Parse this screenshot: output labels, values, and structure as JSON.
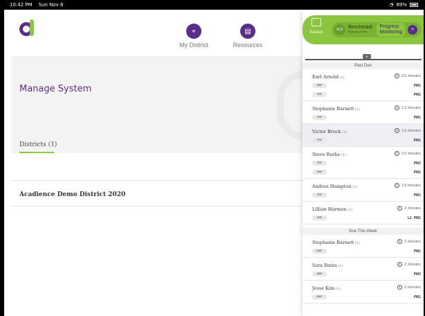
{
  "status_bar": {
    "time": "10:42 PM",
    "date": "Sun Nov 8",
    "wifi_icon": "wifi-icon",
    "battery": "89%"
  },
  "nav": {
    "my_district": {
      "label": "My District",
      "icon": "location-pin-icon"
    },
    "resources": {
      "label": "Resources",
      "icon": "document-icon"
    }
  },
  "page": {
    "title": "Manage System",
    "tab_districts": "Districts (1)"
  },
  "districts": [
    {
      "name": "Acadience Demo District 2020"
    }
  ],
  "panel": {
    "assess_label": "Assess",
    "mode_badge": "K12",
    "benchmark_label": "Benchmark",
    "benchmark_sub": "Beginning of Year",
    "progress_label_1": "Progress",
    "progress_label_2": "Monitoring",
    "handle_label": "III",
    "section_past_due": "Past Due",
    "section_due_week": "Due This Week",
    "past_due": [
      {
        "name": "Earl Arnold",
        "count": "(1)",
        "time": "3.5 minutes",
        "tags": [
          "NWF",
          "PSF"
        ],
        "pms": [
          [
            "",
            "PM1"
          ],
          [
            "",
            "PM1"
          ]
        ]
      },
      {
        "name": "Stephanie Barnett",
        "count": "(1)",
        "time": "1.5 minutes",
        "tags": [
          "PSF"
        ],
        "pms": [
          [
            "",
            "PM1"
          ]
        ]
      },
      {
        "name": "Victor Brock",
        "count": "(1)",
        "time": "1.5 minutes",
        "tags": [
          "PSF"
        ],
        "pms": [
          [
            "",
            "PM1"
          ]
        ],
        "highlight": true
      },
      {
        "name": "Steve Burke",
        "count": "(1)",
        "time": "3.5 minutes",
        "tags": [
          "PSF",
          "NWF"
        ],
        "pms": [
          [
            "",
            "PM2"
          ],
          [
            "",
            "PM1"
          ]
        ]
      },
      {
        "name": "Andrea Hampton",
        "count": "(1)",
        "time": "1.5 minutes",
        "tags": [
          "PSF"
        ],
        "pms": [
          [
            "",
            "PM1"
          ]
        ]
      },
      {
        "name": "Lillian Harmon",
        "count": "(1)",
        "time": "2 minutes",
        "tags": [
          "ORF"
        ],
        "pms": [
          [
            "L2",
            "PM1"
          ]
        ]
      }
    ],
    "due_this_week": [
      {
        "name": "Stephanie Barnett",
        "count": "(1)",
        "time": "2 minutes",
        "tags": [
          "NWF"
        ],
        "pms": [
          [
            "",
            "PM1"
          ]
        ]
      },
      {
        "name": "Sara Bates",
        "count": "(1)",
        "time": "2 minutes",
        "tags": [
          "NWF"
        ],
        "pms": [
          [
            "",
            "PM2"
          ]
        ]
      },
      {
        "name": "Jesse Kim",
        "count": "(1)",
        "time": "2 minutes",
        "tags": [
          "NWF"
        ],
        "pms": [
          [
            "",
            "PM1"
          ]
        ]
      }
    ]
  },
  "colors": {
    "brand_purple": "#5a2d8a",
    "brand_green": "#8cc63f"
  }
}
